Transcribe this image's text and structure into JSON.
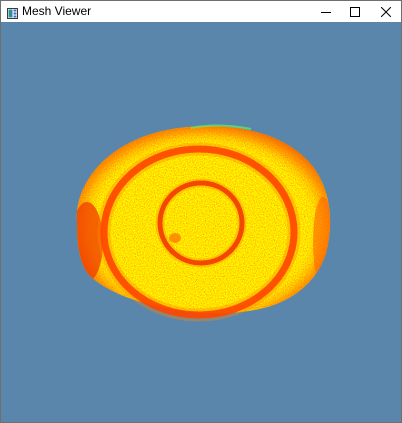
{
  "window": {
    "title": "Mesh Viewer",
    "icon": "app-window-icon"
  },
  "controls": {
    "minimize_icon": "minimize-icon",
    "maximize_icon": "maximize-icon",
    "close_icon": "close-icon"
  },
  "viewport": {
    "background_color": "#5a86ac",
    "mesh": {
      "description_colors": {
        "base": "#ffff00",
        "ring": "#ff2200",
        "edge": "#e61e00",
        "rim_highlight": "#66ee66"
      }
    }
  }
}
